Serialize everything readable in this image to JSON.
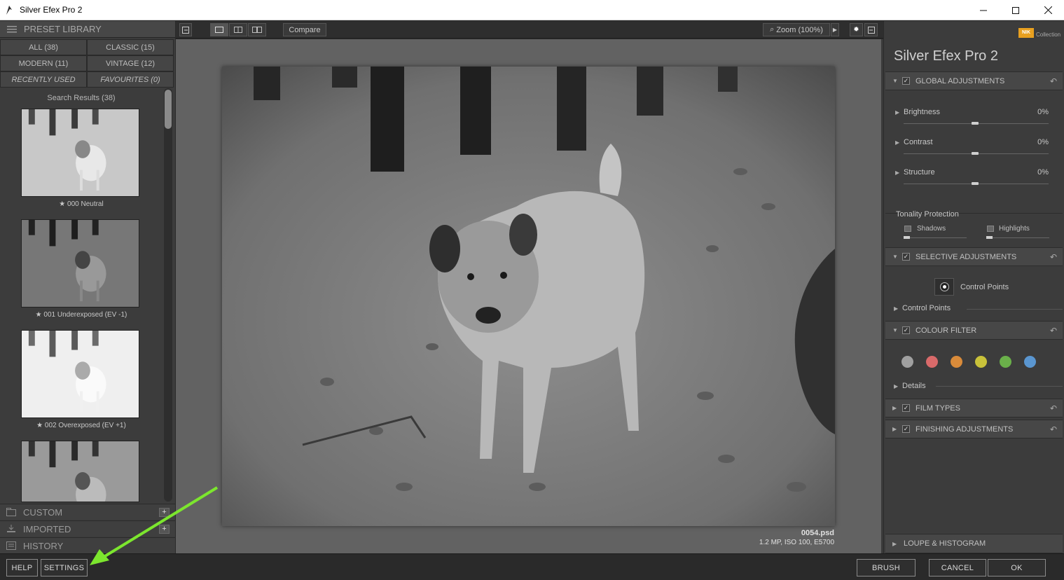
{
  "window": {
    "title": "Silver Efex Pro 2"
  },
  "left_panel": {
    "header": "PRESET LIBRARY",
    "tabs": [
      {
        "label": "ALL (38)"
      },
      {
        "label": "CLASSIC (15)"
      },
      {
        "label": "MODERN (11)"
      },
      {
        "label": "VINTAGE (12)"
      },
      {
        "label": "RECENTLY USED"
      },
      {
        "label": "FAVOURITES (0)"
      }
    ],
    "search_results": "Search Results (38)",
    "presets": [
      {
        "label": "000 Neutral"
      },
      {
        "label": "001 Underexposed (EV -1)"
      },
      {
        "label": "002 Overexposed (EV +1)"
      }
    ],
    "sections": [
      {
        "label": "CUSTOM"
      },
      {
        "label": "IMPORTED"
      },
      {
        "label": "HISTORY"
      }
    ]
  },
  "toolbar": {
    "compare": "Compare",
    "zoom": "Zoom (100%)"
  },
  "canvas": {
    "filename": "0054.psd",
    "fileinfo": "1.2 MP, ISO 100, E5700"
  },
  "right_panel": {
    "brand_logo": "NIK",
    "brand": "Collection",
    "title": "Silver Efex Pro 2",
    "global": {
      "header": "GLOBAL ADJUSTMENTS",
      "sliders": [
        {
          "label": "Brightness",
          "value": "0%"
        },
        {
          "label": "Contrast",
          "value": "0%"
        },
        {
          "label": "Structure",
          "value": "0%"
        }
      ],
      "tonality": {
        "label": "Tonality Protection",
        "shadows": "Shadows",
        "highlights": "Highlights"
      }
    },
    "selective": {
      "header": "SELECTIVE ADJUSTMENTS",
      "control_points_button": "Control Points",
      "control_points_section": "Control Points"
    },
    "colour_filter": {
      "header": "COLOUR FILTER",
      "swatches": [
        "#a0a0a0",
        "#d96a6a",
        "#d98b3a",
        "#c9c23a",
        "#6ab04a",
        "#5a96d0"
      ],
      "details": "Details"
    },
    "film_types": {
      "header": "FILM TYPES"
    },
    "finishing": {
      "header": "FINISHING ADJUSTMENTS"
    },
    "loupe": {
      "header": "LOUPE & HISTOGRAM"
    }
  },
  "bottom": {
    "help": "HELP",
    "settings": "SETTINGS",
    "brush": "BRUSH",
    "cancel": "CANCEL",
    "ok": "OK"
  }
}
